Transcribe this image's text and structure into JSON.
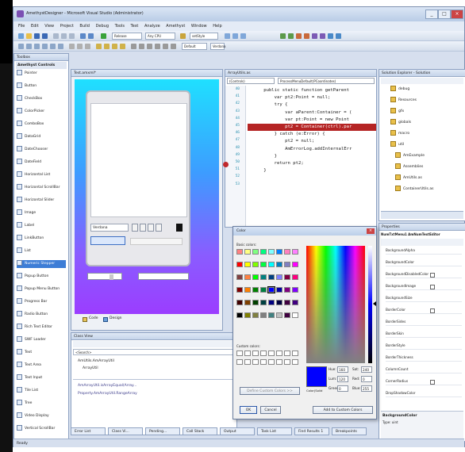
{
  "window": {
    "title": "AmethystDesigner - Microsoft Visual Studio (Administrator)"
  },
  "menu": [
    "File",
    "Edit",
    "View",
    "Project",
    "Build",
    "Debug",
    "Tools",
    "Test",
    "Analyze",
    "Amethyst",
    "Window",
    "Help"
  ],
  "toolbar": {
    "config": "Release",
    "platform": "Any CPU",
    "find": "Default",
    "method": "setStyle",
    "font": "Verdana"
  },
  "toolbox": {
    "title": "Toolbox",
    "group": "Amethyst Controls",
    "items": [
      "Pointer",
      "Button",
      "CheckBox",
      "ColorPicker",
      "ComboBox",
      "DataGrid",
      "DateChooser",
      "DateField",
      "Horizontal List",
      "Horizontal ScrollBar",
      "Horizontal Slider",
      "Image",
      "Label",
      "LinkButton",
      "List",
      "Numeric Stepper",
      "Popup Button",
      "Popup Menu Button",
      "Progress Bar",
      "Radio Button",
      "Rich Text Editor",
      "SWF Loader",
      "Text",
      "Text Area",
      "Text Input",
      "Tile List",
      "Tree",
      "Video Display",
      "Vertical ScrollBar"
    ],
    "selected": 15
  },
  "designer": {
    "tab": "Test.amxml*",
    "font_value": "Verdana",
    "mode_code": "Code",
    "mode_design": "Design"
  },
  "editor": {
    "tab": "ArrayUtils.as",
    "nav_left": "(Controls)",
    "nav_right": "ProcessMenuDefault(PCoordinates)",
    "line_numbers": [
      "40",
      "41",
      "42",
      "43",
      "44",
      "45",
      "46",
      "47",
      "48",
      "49",
      "50",
      "51",
      "52",
      "53"
    ],
    "lines": [
      "      public static function getParent",
      "          var pt2:Point = null;",
      "          try {",
      "              var aParent:Container = (",
      "              var pt:Point = new Point",
      "              pt2 = Container(ctrl).par",
      "          } catch (e:Error) {",
      "              pt2 = null;",
      "              AmErrorLog.addInternalErr",
      "          }",
      "          return pt2;",
      "      }"
    ]
  },
  "solution": {
    "title": "Solution Explorer - Solution 'AmethystDesigner'",
    "items": [
      "debug",
      "Resources",
      "gfx",
      "globals",
      "macro",
      "util",
      "AmExample",
      "Assemblies",
      "AmUtils.as",
      "ContainerUtils.as"
    ]
  },
  "color_dialog": {
    "title": "Color",
    "basic_label": "Basic colors:",
    "custom_label": "Custom colors:",
    "define_button": "Define Custom Colors >>",
    "ok": "OK",
    "cancel": "Cancel",
    "add_custom": "Add to Custom Colors",
    "color_solid_label": "Color|Solid",
    "fields": [
      {
        "label": "Hue:",
        "value": "160"
      },
      {
        "label": "Sat:",
        "value": "240"
      },
      {
        "label": "Lum:",
        "value": "120"
      },
      {
        "label": "Red:",
        "value": "0"
      },
      {
        "label": "Green:",
        "value": "0"
      },
      {
        "label": "Blue:",
        "value": "255"
      }
    ],
    "basic_colors": [
      "#ff8080",
      "#ffff80",
      "#80ff80",
      "#00ff80",
      "#80ffff",
      "#0080ff",
      "#ff80c0",
      "#ff80ff",
      "#ff0000",
      "#ffff00",
      "#80ff00",
      "#00ff40",
      "#00ffff",
      "#0080c0",
      "#8080c0",
      "#ff00ff",
      "#804040",
      "#ff8040",
      "#00ff00",
      "#008080",
      "#004080",
      "#8080ff",
      "#800040",
      "#ff0080",
      "#800000",
      "#ff8000",
      "#008000",
      "#008040",
      "#0000ff",
      "#0000a0",
      "#800080",
      "#8000ff",
      "#400000",
      "#804000",
      "#004000",
      "#004040",
      "#000080",
      "#000040",
      "#400040",
      "#400080",
      "#000000",
      "#808000",
      "#808040",
      "#808080",
      "#408080",
      "#c0c0c0",
      "#400040",
      "#ffffff"
    ],
    "selected_color": "#0000ff"
  },
  "properties": {
    "title": "Properties",
    "object": "NumTxtMenu1 AmNumTextEditor",
    "names": [
      "BackgroundAlpha",
      "BackgroundColor",
      "BackgroundDisabledColor",
      "BackgroundImage",
      "BackgroundSize",
      "BorderColor",
      "BorderSides",
      "BorderSkin",
      "BorderStyle",
      "BorderThickness",
      "ColumnCount",
      "CornerRadius",
      "DropShadowColor"
    ],
    "footer_name": "BackgroundColor",
    "footer_desc": "Type: uint"
  },
  "classview": {
    "title": "Class View",
    "search": "<Search>",
    "tree": [
      "AmUtils.AmArrayUtil",
      "ArrayUtil"
    ],
    "members": [
      "AmArrayUtil.isArrayEqual(Array...",
      "Property.AmArrayUtil.RangeArray"
    ]
  },
  "bottom_tabs": [
    "Error List",
    "Class Vi...",
    "Pending...",
    "Call Stack",
    "Output",
    "Task List",
    "Find Results 1",
    "Breakpoints"
  ],
  "status": "Ready"
}
